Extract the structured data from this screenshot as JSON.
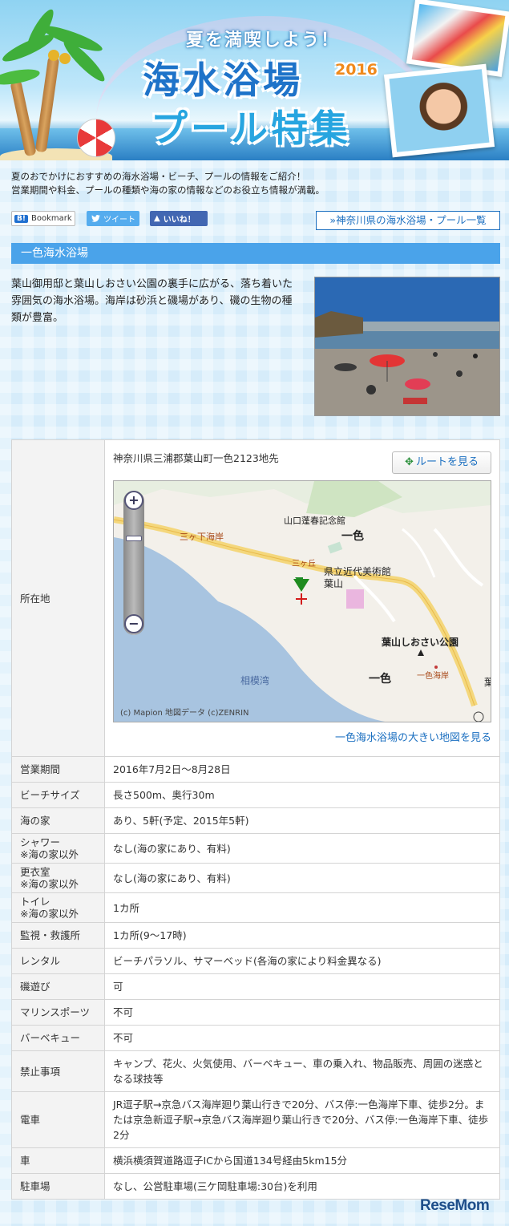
{
  "banner": {
    "subtitle": "夏を満喫しよう！",
    "title_line1": "海水浴場",
    "year": "2016",
    "title_line2": "プール特集"
  },
  "intro": {
    "line1": "夏のおでかけにおすすめの海水浴場・ビーチ、プールの情報をご紹介！",
    "line2": "営業期間や料金、プールの種類や海の家の情報などのお役立ち情報が満載。"
  },
  "social": {
    "bookmark_badge": "B!",
    "bookmark": "Bookmark",
    "tweet": "ツイート",
    "like": "いいね！"
  },
  "list_link": "»神奈川県の海水浴場・プール一覧",
  "section_title": "一色海水浴場",
  "description": "葉山御用邸と葉山しおさい公園の裏手に広がる、落ち着いた雰囲気の海水浴場。海岸は砂浜と磯場があり、磯の生物の種類が豊富。",
  "address": {
    "label": "所在地",
    "value": "神奈川県三浦郡葉山町一色2123地先",
    "route_button": "ルートを見る",
    "map_link": "一色海水浴場の大きい地図を見る"
  },
  "map": {
    "labels": {
      "museum": "山口蓬春記念館",
      "isshiki_top": "一色",
      "mikkage": "三ヶ下海岸",
      "sangaoka": "三ヶ丘",
      "kenritsu": "県立近代美術館",
      "hayama": "葉山",
      "park": "葉山しおさい公園",
      "isshiki_bottom": "一色",
      "isshiki_coast": "一色海岸",
      "sagami_bay": "相模湾",
      "ha": "葉",
      "copyright": "(c) Mapion 地図データ (c)ZENRIN"
    },
    "zoom_in": "+",
    "zoom_out": "−"
  },
  "rows": [
    {
      "label": "営業期間",
      "value": "2016年7月2日～8月28日"
    },
    {
      "label": "ビーチサイズ",
      "value": "長さ500m、奥行30m"
    },
    {
      "label": "海の家",
      "value": "あり、5軒(予定、2015年5軒)"
    },
    {
      "label": "シャワー",
      "note": "※海の家以外",
      "value": "なし(海の家にあり、有料)"
    },
    {
      "label": "更衣室",
      "note": "※海の家以外",
      "value": "なし(海の家にあり、有料)"
    },
    {
      "label": "トイレ",
      "note": "※海の家以外",
      "value": "1カ所"
    },
    {
      "label": "監視・救護所",
      "value": "1カ所(9～17時)"
    },
    {
      "label": "レンタル",
      "value": "ビーチパラソル、サマーベッド(各海の家により料金異なる)"
    },
    {
      "label": "磯遊び",
      "value": "可"
    },
    {
      "label": "マリンスポーツ",
      "value": "不可"
    },
    {
      "label": "バーベキュー",
      "value": "不可"
    },
    {
      "label": "禁止事項",
      "value": "キャンプ、花火、火気使用、バーベキュー、車の乗入れ、物品販売、周囲の迷惑となる球技等"
    },
    {
      "label": "電車",
      "value": "JR逗子駅→京急バス海岸廻り葉山行きで20分、バス停:一色海岸下車、徒歩2分。または京急新逗子駅→京急バス海岸廻り葉山行きで20分、バス停:一色海岸下車、徒歩2分"
    },
    {
      "label": "車",
      "value": "横浜横須賀道路逗子ICから国道134号経由5km15分"
    },
    {
      "label": "駐車場",
      "value": "なし、公営駐車場(三ケ岡駐車場:30台)を利用"
    }
  ],
  "watermark": "ReseMom"
}
